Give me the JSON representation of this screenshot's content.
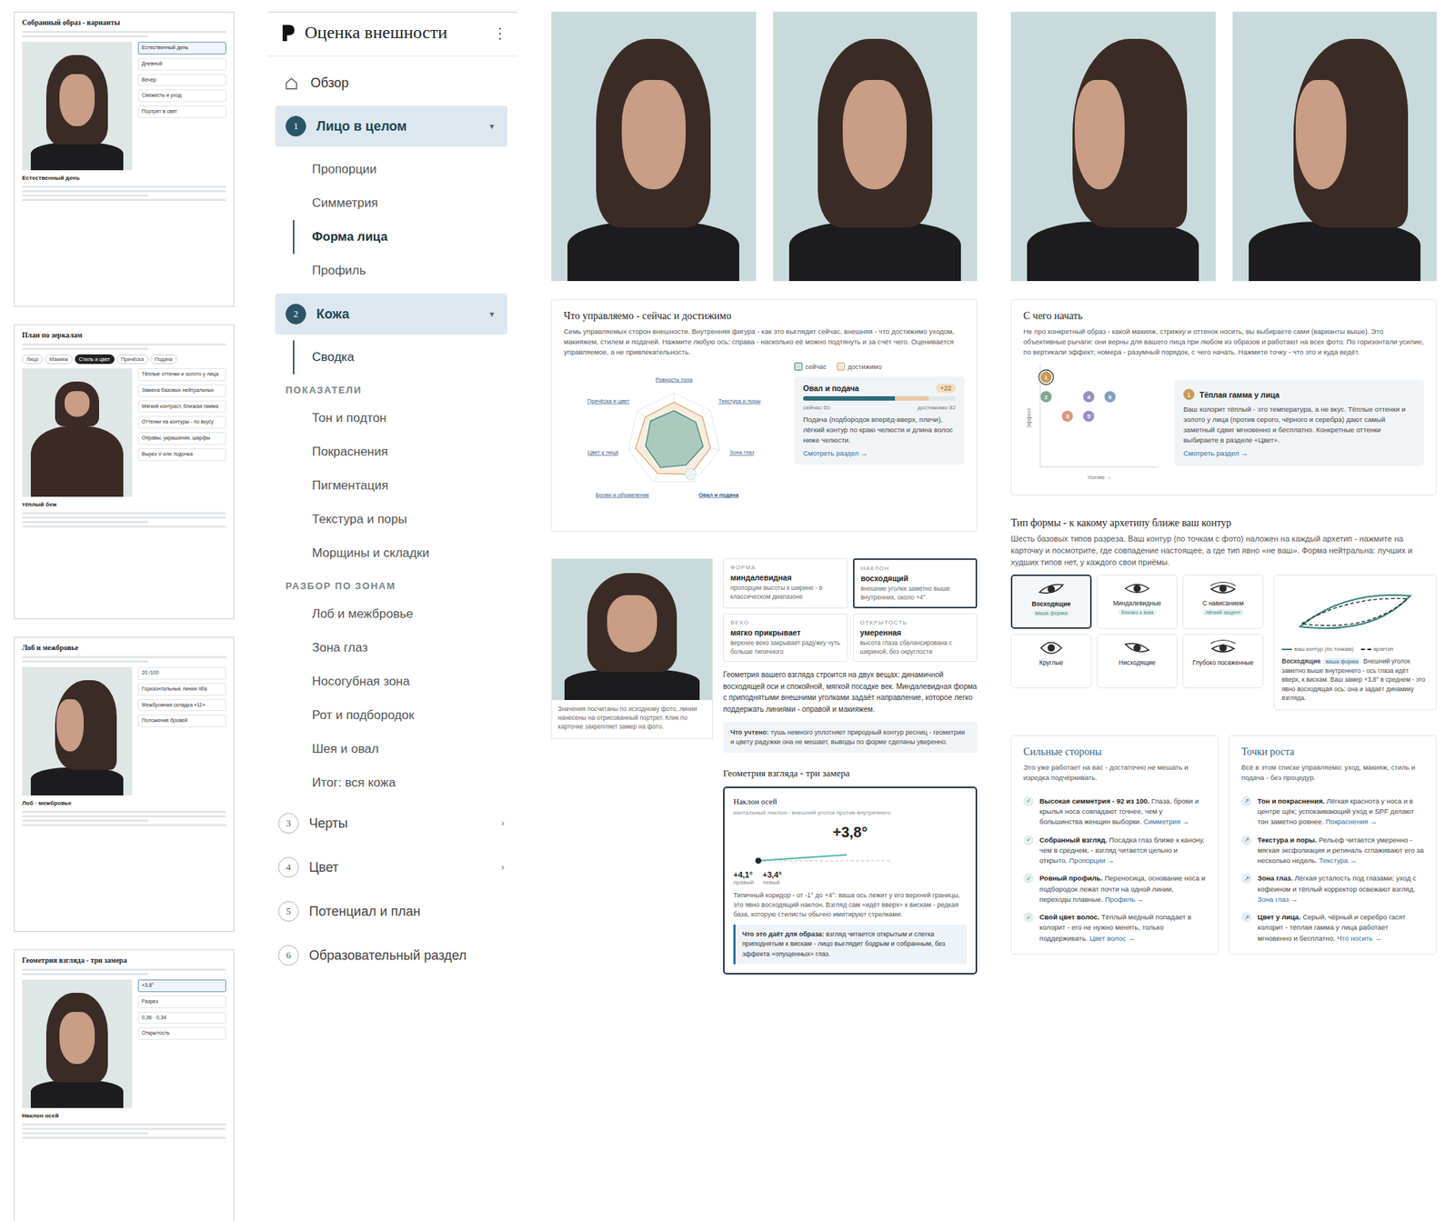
{
  "app": {
    "title": "Оценка внешности",
    "menu": "⋮"
  },
  "nav": [
    {
      "kind": "link",
      "label": "Обзор",
      "selected": false
    },
    {
      "kind": "section",
      "number": "1",
      "label": "Лицо в целом",
      "arrow": "▾",
      "expanded": true,
      "children": [
        {
          "kind": "item",
          "label": "Пропорции",
          "selected": false,
          "marked": false
        },
        {
          "kind": "item",
          "label": "Симметрия",
          "selected": false,
          "marked": false
        },
        {
          "kind": "item",
          "label": "Форма лица",
          "selected": true,
          "marked": true
        },
        {
          "kind": "item",
          "label": "Профиль",
          "selected": false,
          "marked": false
        }
      ]
    },
    {
      "kind": "section",
      "number": "2",
      "label": "Кожа",
      "arrow": "▾",
      "expanded": true,
      "children": [
        {
          "kind": "item",
          "label": "Сводка",
          "selected": false,
          "marked": true
        },
        {
          "kind": "heading",
          "label": "ПОКАЗАТЕЛИ"
        },
        {
          "kind": "item",
          "label": "Тон и подтон",
          "selected": false,
          "marked": false
        },
        {
          "kind": "item",
          "label": "Покраснения",
          "selected": false,
          "marked": false
        },
        {
          "kind": "item",
          "label": "Пигментация",
          "selected": false,
          "marked": false
        },
        {
          "kind": "item",
          "label": "Текстура и поры",
          "selected": false,
          "marked": false
        },
        {
          "kind": "item",
          "label": "Морщины и складки",
          "selected": false,
          "marked": false
        },
        {
          "kind": "heading",
          "label": "РАЗБОР ПО ЗОНАМ"
        },
        {
          "kind": "item",
          "label": "Лоб и межбровье",
          "selected": false,
          "marked": false
        },
        {
          "kind": "item",
          "label": "Зона глаз",
          "selected": false,
          "marked": false
        },
        {
          "kind": "item",
          "label": "Носогубная зона",
          "selected": false,
          "marked": false
        },
        {
          "kind": "item",
          "label": "Рот и подбородок",
          "selected": false,
          "marked": false
        },
        {
          "kind": "item",
          "label": "Шея и овал",
          "selected": false,
          "marked": false
        },
        {
          "kind": "item",
          "label": "Итог: вся кожа",
          "selected": false,
          "marked": false
        }
      ]
    },
    {
      "kind": "section",
      "number": "3",
      "label": "Черты",
      "arrow": "›",
      "expanded": false,
      "children": []
    },
    {
      "kind": "section",
      "number": "4",
      "label": "Цвет",
      "arrow": "›",
      "expanded": false,
      "children": []
    },
    {
      "kind": "section",
      "number": "5",
      "label": "Потенциал и план",
      "arrow": "",
      "expanded": false,
      "children": []
    },
    {
      "kind": "section",
      "number": "6",
      "label": "Образовательный раздел",
      "arrow": "",
      "expanded": false,
      "children": []
    }
  ],
  "thumbnails": [
    {
      "title": "Собранный образ - варианты",
      "view": "front",
      "tabs": [],
      "caption": "Естественный день",
      "items": [
        {
          "label": "Естественный день",
          "selected": true
        },
        {
          "label": "Дневной",
          "selected": false
        },
        {
          "label": "Вечер",
          "selected": false
        },
        {
          "label": "Свежесть и уход",
          "selected": false
        },
        {
          "label": "Портрет в свет",
          "selected": false
        }
      ]
    },
    {
      "title": "План по зеркалам",
      "view": "body",
      "tabs": [
        {
          "label": "Лицо",
          "selected": false
        },
        {
          "label": "Макияж",
          "selected": false
        },
        {
          "label": "Стиль и цвет",
          "selected": true
        },
        {
          "label": "Причёска",
          "selected": false
        },
        {
          "label": "Подача",
          "selected": false
        }
      ],
      "caption": "тёплый беж",
      "items": [
        {
          "label": "Тёплые оттенки и золото у лица",
          "selected": false
        },
        {
          "label": "Замена базовых нейтральных",
          "selected": false
        },
        {
          "label": "Мягкий контраст, близкая гамма",
          "selected": false
        },
        {
          "label": "Оттенки на контуры - по вкусу",
          "selected": false
        },
        {
          "label": "Оправы, украшения, шарфы",
          "selected": false
        },
        {
          "label": "Вырез V или лодочка",
          "selected": false
        }
      ]
    },
    {
      "title": "Лоб и межбровье",
      "view": "profile",
      "tabs": [],
      "caption": "Лоб · межбровье",
      "items": [
        {
          "label": "20 /100",
          "selected": false
        },
        {
          "label": "Горизонтальные линии лба",
          "selected": false
        },
        {
          "label": "Межбровная складка «11»",
          "selected": false
        },
        {
          "label": "Положение бровей",
          "selected": false
        }
      ]
    },
    {
      "title": "Геометрия взгляда - три замера",
      "view": "front",
      "tabs": [],
      "caption": "Наклон осей",
      "items": [
        {
          "label": "+3,8°",
          "selected": true
        },
        {
          "label": "Разрез",
          "selected": false
        },
        {
          "label": "0,36 · 0,34",
          "selected": false
        },
        {
          "label": "Открытость",
          "selected": false
        }
      ]
    }
  ],
  "photos": [
    {
      "view": "front"
    },
    {
      "view": "front"
    },
    {
      "view": "profile"
    },
    {
      "view": "profile"
    }
  ],
  "radar": {
    "title": "Что управляемо - сейчас и достижимо",
    "description": "Семь управляемых сторон внешности. Внутренняя фигура - как это выглядит сейчас, внешняя - что достижимо уходом, макияжем, стилем и подачей. Нажмите любую ось: справа - насколько её можно подтянуть и за счёт чего. Оценивается управляемое, а не привлекательность.",
    "legend": {
      "now": "сейчас",
      "target": "достижимо"
    },
    "axes": [
      {
        "label": "Ровность тона",
        "now": 62,
        "target": 80,
        "selected": false
      },
      {
        "label": "Текстура и поры",
        "now": 60,
        "target": 78,
        "selected": false
      },
      {
        "label": "Зона глаз",
        "now": 64,
        "target": 80,
        "selected": false
      },
      {
        "label": "Овал и подача",
        "now": 60,
        "target": 82,
        "selected": true
      },
      {
        "label": "Брови и обрамление",
        "now": 66,
        "target": 80,
        "selected": false
      },
      {
        "label": "Цвет у лица",
        "now": 62,
        "target": 84,
        "selected": false
      },
      {
        "label": "Причёска и цвет",
        "now": 64,
        "target": 78,
        "selected": false
      }
    ],
    "detail": {
      "title": "Овал и подача",
      "delta": "+22",
      "now": {
        "label": "сейчас 60",
        "level": 0.6
      },
      "target": {
        "label": "достижимо 82",
        "level": 0.82
      },
      "text": "Подача (подбородок вперёд-вверх, плечи), лёгкий контур по краю челюсти и длина волос ниже челюсти.",
      "link": "Смотреть раздел →"
    }
  },
  "start": {
    "title": "С чего начать",
    "description": "Не про конкретный образ - какой макияж, стрижку и оттенок носить, вы выбираете сами (варианты выше). Это объективные рычаги: они верны для вашего лица при любом из образов и работают на всех фото. По горизонтали усилие, по вертикали эффект; номера - разумный порядок, с чего начать. Нажмите точку - что это и куда ведёт.",
    "y_axis": "Эффект",
    "x_axis": "Усилие →",
    "points": [
      {
        "number": "1",
        "effort": 0.5,
        "effect": 9.2,
        "color": "#c89a5a",
        "selected": true
      },
      {
        "number": "2",
        "effort": 0.5,
        "effect": 7.2,
        "color": "#7fa88a",
        "selected": false
      },
      {
        "number": "3",
        "effort": 2.3,
        "effect": 5.2,
        "color": "#d99a84",
        "selected": false
      },
      {
        "number": "4",
        "effort": 4.1,
        "effect": 7.2,
        "color": "#9a8ec2",
        "selected": false
      },
      {
        "number": "5",
        "effort": 4.1,
        "effect": 5.2,
        "color": "#9a8ec2",
        "selected": false
      },
      {
        "number": "6",
        "effort": 5.9,
        "effect": 7.2,
        "color": "#7fa0c2",
        "selected": false
      }
    ],
    "detail": {
      "number": "1",
      "title": "Тёплая гамма у лица",
      "text": "Ваш колорит тёплый - это температура, а не вкус. Тёплые оттенки и золото у лица (против серого, чёрного и серебра) дают самый заметный сдвиг мгновенно и бесплатно. Конкретные оттенки выбираете в разделе «Цвет».",
      "link": "Смотреть раздел →"
    }
  },
  "eyes": {
    "caption": "Значения посчитаны по исходному фото, линии нанесены на отрисованный портрет. Клик по карточке закрепляет замер на фото.",
    "cards": [
      {
        "label": "ФОРМА",
        "value": "миндалевидная",
        "text": "пропорции высоты к ширине - в классическом диапазоне",
        "selected": false
      },
      {
        "label": "НАКЛОН",
        "value": "восходящий",
        "text": "внешние уголки заметно выше внутренних, около +4°",
        "selected": true
      },
      {
        "label": "ВЕКО",
        "value": "мягко прикрывает",
        "text": "верхнее веко закрывает радужку чуть больше типичного",
        "selected": false
      },
      {
        "label": "ОТКРЫТОСТЬ",
        "value": "умеренная",
        "text": "высота глаза сбалансирована с шириной, без округлости",
        "selected": false
      }
    ],
    "summary": "Геометрия вашего взгляда строится на двух вещах: динамичной восходящей оси и спокойной, мягкой посадке век. Миндалевидная форма с приподнятыми внешними уголками задаёт направление, которое легко поддержать линиями - оправой и макияжем.",
    "note_label": "Что учтено:",
    "note": "тушь немного уплотняет природный контур ресниц - геометрии и цвету радужки она не мешает, выводы по форме сделаны уверенно."
  },
  "geometry": {
    "heading": "Геометрия взгляда - три замера",
    "title": "Наклон осей",
    "subtitle": "кантальный наклон - внешний уголок против внутреннего",
    "value": "+3,8°",
    "tilt_deg": 3.8,
    "sides": [
      {
        "value": "+4,1°",
        "label": "правый"
      },
      {
        "value": "+3,4°",
        "label": "левый"
      }
    ],
    "text": "Типичный коридор - от -1° до +4°: ваша ось лежит у его верхней границы, это явно восходящий наклон. Взгляд сам «идёт вверх» к вискам - редкая база, которую стилисты обычно имитируют стрелками.",
    "callout_label": "Что это даёт для образа:",
    "callout": "взгляд читается открытым и слегка приподнятым к вискам - лицо выглядит бодрым и собранным, без эффекта «опущенных» глаз."
  },
  "shapes": {
    "title": "Тип формы - к какому архетипу ближе ваш контур",
    "description": "Шесть базовых типов разреза. Ваш контур (по точкам с фото) наложен на каждый архетип - нажмите на карточку и посмотрите, где совпадение настоящее, а где тип явно «не ваш». Форма нейтральна: лучших и худших типов нет, у каждого свои приёмы.",
    "types": [
      {
        "label": "Восходящие",
        "badge": "ваша форма",
        "selected": true
      },
      {
        "label": "Миндалевидные",
        "badge": "близко к вам",
        "selected": false
      },
      {
        "label": "С нависанием",
        "badge": "лёгкий акцент",
        "selected": false
      },
      {
        "label": "Круглые",
        "badge": "",
        "selected": false
      },
      {
        "label": "Нисходящие",
        "badge": "",
        "selected": false
      },
      {
        "label": "Глубоко посаженные",
        "badge": "",
        "selected": false
      }
    ],
    "legend": {
      "yours": "ваш контур (по точкам)",
      "archetype": "архетип"
    },
    "detail": {
      "title": "Восходящие",
      "badge": "ваша форма",
      "text": "Внешний уголок заметно выше внутреннего - ось глаза идёт вверх, к вискам. Ваш замер +3,8° в среднем - это явно восходящая ось: она и задаёт динамику взгляда."
    }
  },
  "strengths": {
    "title": "Сильные стороны",
    "description": "Это уже работает на вас - достаточно не мешать и изредка подчёркивать.",
    "mark": "✓",
    "items": [
      {
        "title": "Высокая симметрия - 92 из 100.",
        "text": "Глаза, брови и крылья носа совпадают точнее, чем у большинства женщин выборки.",
        "link": "Симметрия →"
      },
      {
        "title": "Собранный взгляд.",
        "text": "Посадка глаз ближе к канону, чем в среднем, - взгляд читается цельно и открыто.",
        "link": "Пропорции →"
      },
      {
        "title": "Ровный профиль.",
        "text": "Переносица, основание носа и подбородок лежат почти на одной линии, переходы плавные.",
        "link": "Профиль →"
      },
      {
        "title": "Свой цвет волос.",
        "text": "Тёплый медный попадает в колорит - его не нужно менять, только поддерживать.",
        "link": "Цвет волос →"
      }
    ]
  },
  "growth": {
    "title": "Точки роста",
    "description": "Всё в этом списке управляемо: уход, макияж, стиль и подача - без процедур.",
    "mark": "↗",
    "items": [
      {
        "title": "Тон и покраснения.",
        "text": "Лёгкая краснота у носа и в центре щёк; успокаивающий уход и SPF делают тон заметно ровнее.",
        "link": "Покраснения →"
      },
      {
        "title": "Текстура и поры.",
        "text": "Рельеф читается умеренно - мягкая эксфолиация и ретиналь сглаживают его за несколько недель.",
        "link": "Текстура →"
      },
      {
        "title": "Зона глаз.",
        "text": "Лёгкая усталость под глазами; уход с кофеином и тёплый корректор освежают взгляд.",
        "link": "Зона глаз →"
      },
      {
        "title": "Цвет у лица.",
        "text": "Серый, чёрный и серебро гасят колорит - тёплая гамма у лица работает мгновенно и бесплатно.",
        "link": "Что носить →"
      }
    ]
  }
}
